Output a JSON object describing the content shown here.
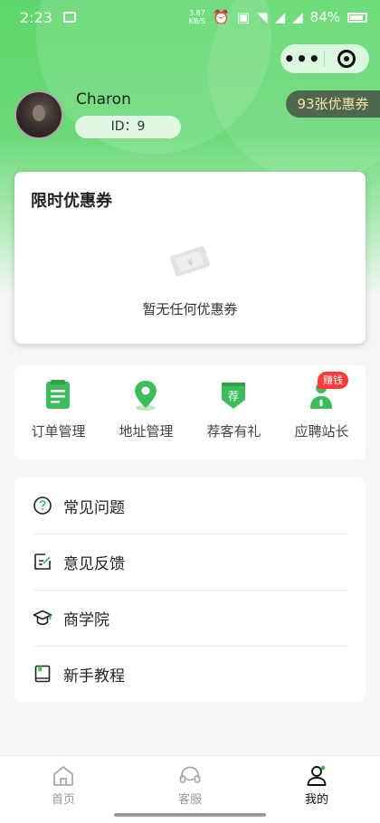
{
  "status_bar": {
    "time": "2:23",
    "speed_value": "3.87",
    "speed_unit": "KB/S",
    "battery": "84%"
  },
  "capsule": {
    "more": "•••"
  },
  "profile": {
    "name": "Charon",
    "id_text": "ID：9",
    "coupon_count_text": "93张优惠券"
  },
  "coupon_card": {
    "title": "限时优惠券",
    "empty_text": "暂无任何优惠券"
  },
  "shortcuts": [
    {
      "label": "订单管理",
      "icon": "order-icon"
    },
    {
      "label": "地址管理",
      "icon": "location-pin-icon"
    },
    {
      "label": "荐客有礼",
      "icon": "recommend-badge-icon",
      "icon_text": "荐"
    },
    {
      "label": "应聘站长",
      "icon": "person-apply-icon",
      "badge": "赚钱"
    }
  ],
  "menu": [
    {
      "label": "常见问题",
      "icon": "question-circle-icon"
    },
    {
      "label": "意见反馈",
      "icon": "feedback-edit-icon"
    },
    {
      "label": "商学院",
      "icon": "graduation-cap-icon"
    },
    {
      "label": "新手教程",
      "icon": "book-icon"
    }
  ],
  "tabbar": [
    {
      "label": "首页",
      "icon": "home-icon",
      "active": false
    },
    {
      "label": "客服",
      "icon": "headset-icon",
      "active": false
    },
    {
      "label": "我的",
      "icon": "user-icon",
      "active": true
    }
  ],
  "colors": {
    "brand_green": "#3dbd5a",
    "badge_red": "#ff3b3b",
    "coupon_gold": "#ffe0a6"
  }
}
